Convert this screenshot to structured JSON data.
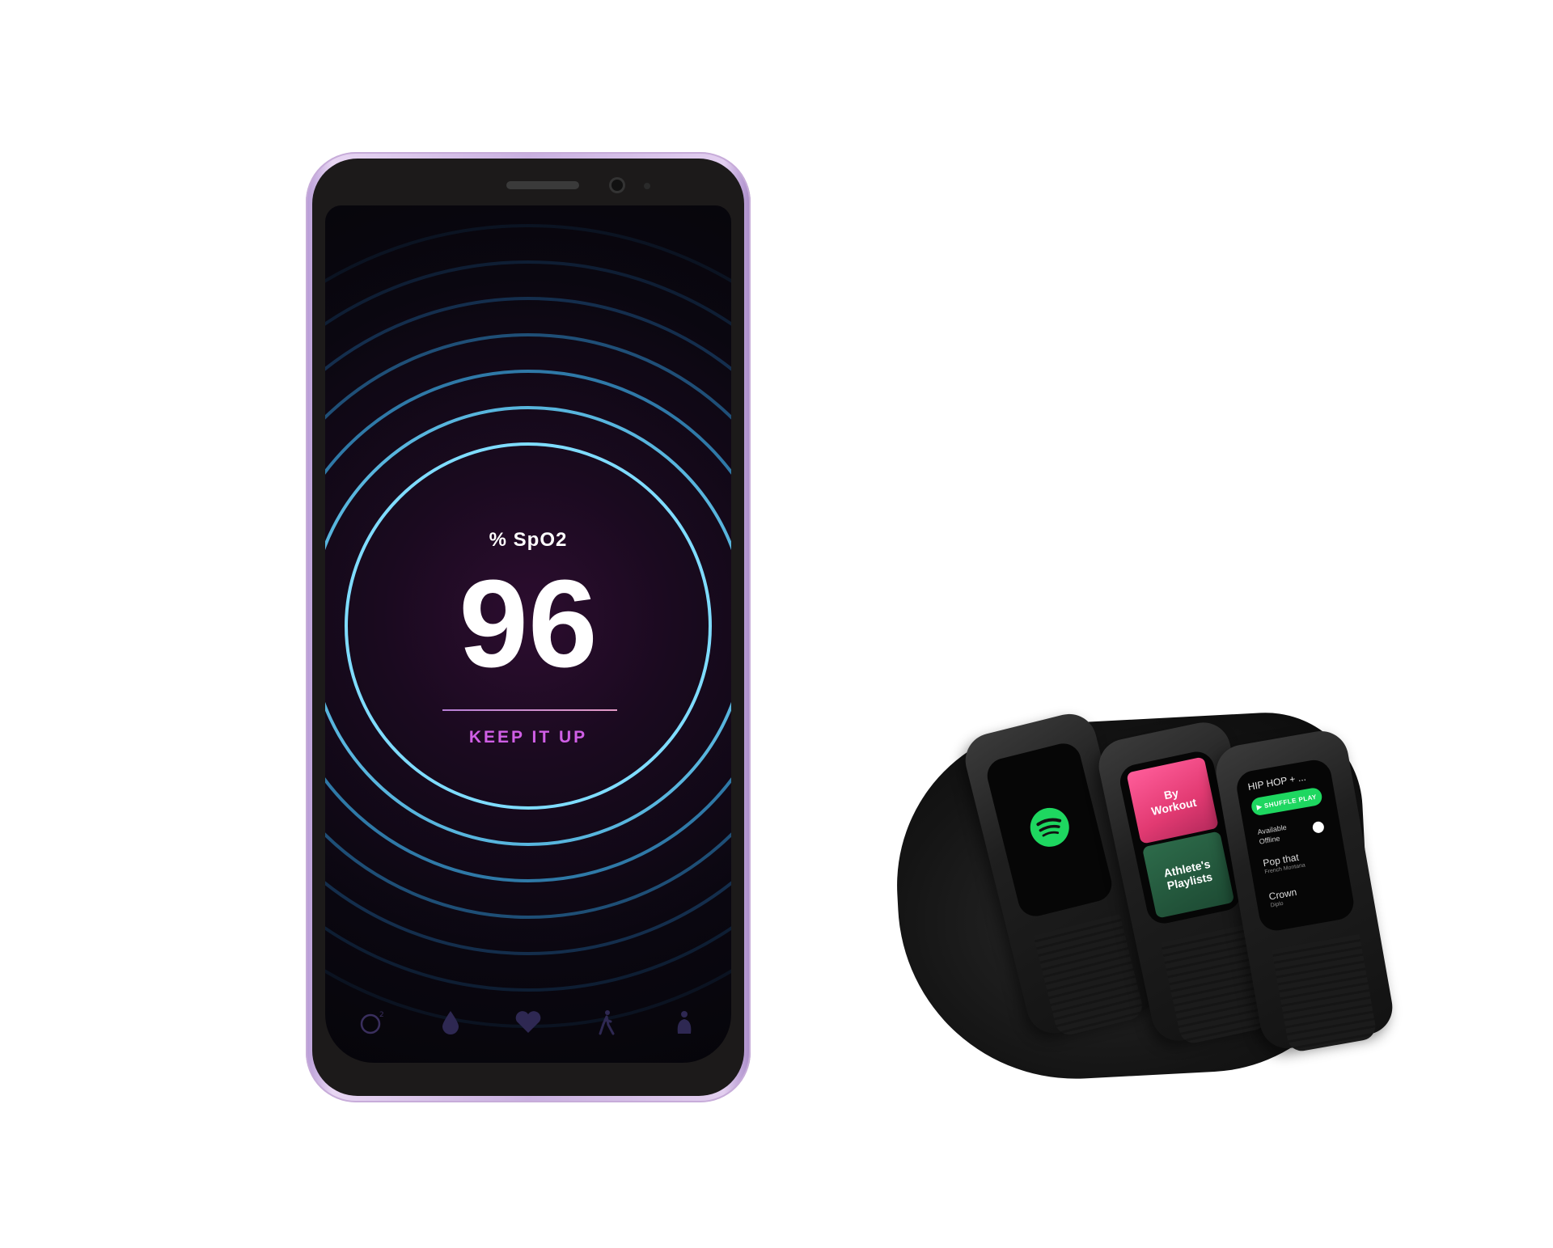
{
  "phone": {
    "metric_label": "% SpO2",
    "metric_value": "96",
    "status_text": "KEEP IT UP",
    "nav_icons": [
      "oxygen-icon",
      "drop-icon",
      "heart-icon",
      "walk-icon",
      "meditation-icon"
    ]
  },
  "watches": {
    "watch1": {
      "app_icon": "spotify-icon"
    },
    "watch2": {
      "tile1": "By\nWorkout",
      "tile2": "Athlete's\nPlaylists"
    },
    "watch3": {
      "header": "HIP HOP + ...",
      "shuffle_button": "▶ SHUFFLE PLAY",
      "offline_label": "Available\nOffline",
      "tracks": [
        {
          "title": "Pop that",
          "artist": "French Montana"
        },
        {
          "title": "Crown",
          "artist": "Diplo"
        }
      ]
    }
  },
  "colors": {
    "ring": "#6ed6ff",
    "status": "#d05fe6",
    "spotify_green": "#1ed760"
  }
}
